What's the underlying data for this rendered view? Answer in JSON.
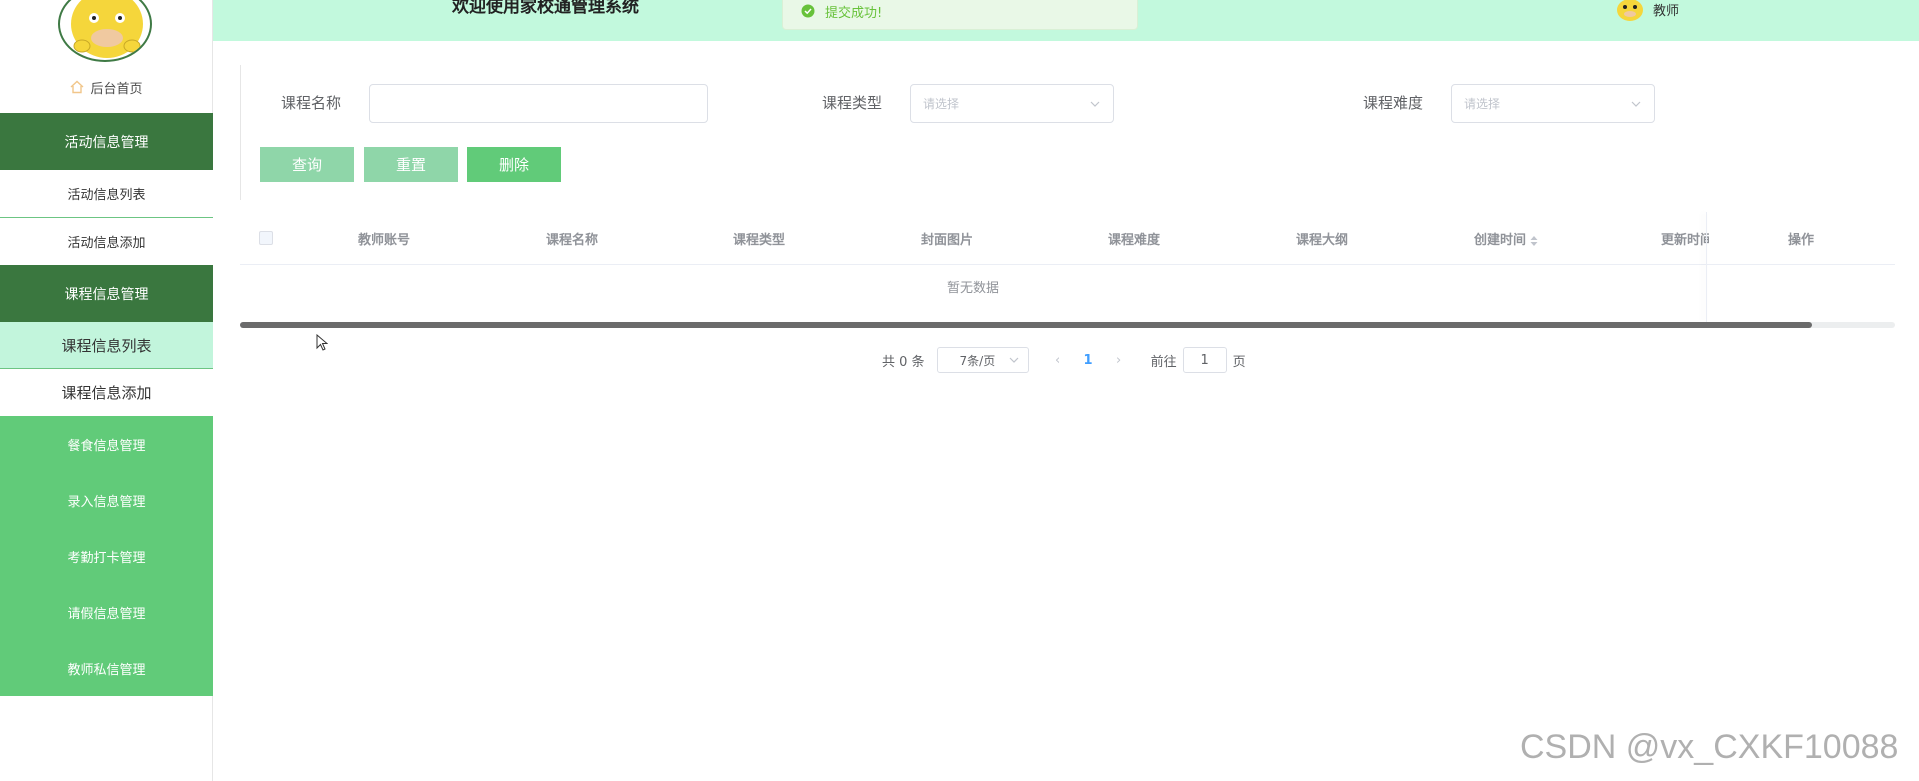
{
  "sidebar": {
    "home_label": "后台首页",
    "menu": [
      {
        "type": "group",
        "label": "活动信息管理"
      },
      {
        "type": "item",
        "label": "活动信息列表"
      },
      {
        "type": "item",
        "label": "活动信息添加"
      },
      {
        "type": "group",
        "label": "课程信息管理"
      },
      {
        "type": "item",
        "label": "课程信息列表",
        "active": true
      },
      {
        "type": "item",
        "label": "课程信息添加"
      },
      {
        "type": "collapsed",
        "label": "餐食信息管理"
      },
      {
        "type": "collapsed",
        "label": "录入信息管理"
      },
      {
        "type": "collapsed",
        "label": "考勤打卡管理"
      },
      {
        "type": "collapsed",
        "label": "请假信息管理"
      },
      {
        "type": "collapsed",
        "label": "教师私信管理"
      }
    ]
  },
  "header": {
    "title": "欢迎使用家校通管理系统",
    "toast": "提交成功!",
    "username": "教师"
  },
  "filters": {
    "course_name_label": "课程名称",
    "course_name_value": "",
    "course_type_label": "课程类型",
    "course_type_placeholder": "请选择",
    "course_level_label": "课程难度",
    "course_level_placeholder": "请选择"
  },
  "buttons": {
    "query": "查询",
    "reset": "重置",
    "delete": "删除"
  },
  "table": {
    "columns": [
      "教师账号",
      "课程名称",
      "课程类型",
      "封面图片",
      "课程难度",
      "课程大纲",
      "创建时间",
      "更新时间",
      "操作"
    ],
    "empty_text": "暂无数据"
  },
  "pagination": {
    "total_text": "共 0 条",
    "page_size": "7条/页",
    "current_page": "1",
    "goto_label": "前往",
    "goto_value": "1",
    "page_suffix": "页"
  },
  "watermark": "CSDN @vx_CXKF10088",
  "colors": {
    "sidebar_group_bg": "#3a773f",
    "sidebar_collapsed_bg": "#61cb79",
    "active_item_bg": "#c2f5dc",
    "topbar_bg": "#c2f9dd",
    "button_light": "#8fd6a9",
    "button_solid": "#61cb79"
  }
}
